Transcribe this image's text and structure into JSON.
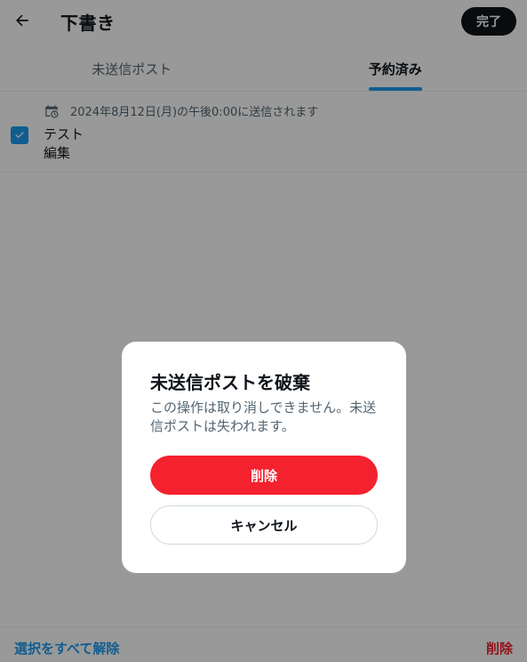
{
  "header": {
    "back_icon": "arrow-left-icon",
    "title": "下書き",
    "done_label": "完了"
  },
  "tabs": [
    {
      "label": "未送信ポスト",
      "active": false
    },
    {
      "label": "予約済み",
      "active": true
    }
  ],
  "draft": {
    "selected": true,
    "schedule_icon": "calendar-clock-icon",
    "schedule_text": "2024年8月12日(月)の午後0:00に送信されます",
    "text": "テスト",
    "edit_label": "編集"
  },
  "footer": {
    "select_all_label": "選択をすべて解除",
    "delete_label": "削除"
  },
  "dialog": {
    "title": "未送信ポストを破棄",
    "message": "この操作は取り消しできません。未送信ポストは失われます。",
    "confirm_label": "削除",
    "cancel_label": "キャンセル"
  },
  "colors": {
    "accent": "#1d9bf0",
    "danger": "#f4212e",
    "text_primary": "#0f1419",
    "text_secondary": "#536471"
  }
}
